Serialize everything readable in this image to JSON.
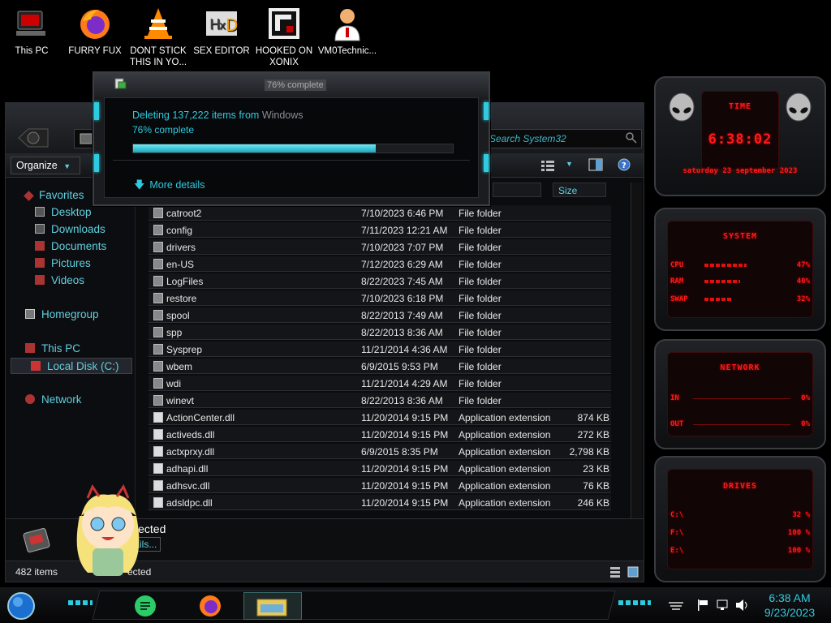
{
  "desktop": {
    "icons": [
      {
        "label": "This PC"
      },
      {
        "label": "FURRY FUX"
      },
      {
        "label": "DONT STICK THIS IN YO..."
      },
      {
        "label": "SEX EDITOR"
      },
      {
        "label": "HOOKED ON XONIX"
      },
      {
        "label": "VM0Technic..."
      }
    ]
  },
  "dialog": {
    "title": "76% complete",
    "heading_prefix": "Deleting 137,222 items from ",
    "heading_location": "Windows",
    "percent_text": "76% complete",
    "progress_value": 0.76,
    "more_details": "More details"
  },
  "explorer": {
    "search_placeholder": "Search System32",
    "organize": "Organize",
    "nav": {
      "favorites": "Favorites",
      "desktop": "Desktop",
      "downloads": "Downloads",
      "documents": "Documents",
      "pictures": "Pictures",
      "videos": "Videos",
      "homegroup": "Homegroup",
      "this_pc": "This PC",
      "local_disk": "Local Disk (C:)",
      "network": "Network"
    },
    "columns": {
      "size": "Size"
    },
    "rows": [
      {
        "name": "catroot2",
        "date": "7/10/2023 6:46 PM",
        "type": "File folder",
        "size": ""
      },
      {
        "name": "config",
        "date": "7/11/2023 12:21 AM",
        "type": "File folder",
        "size": ""
      },
      {
        "name": "drivers",
        "date": "7/10/2023 7:07 PM",
        "type": "File folder",
        "size": ""
      },
      {
        "name": "en-US",
        "date": "7/12/2023 6:29 AM",
        "type": "File folder",
        "size": ""
      },
      {
        "name": "LogFiles",
        "date": "8/22/2023 7:45 AM",
        "type": "File folder",
        "size": ""
      },
      {
        "name": "restore",
        "date": "7/10/2023 6:18 PM",
        "type": "File folder",
        "size": ""
      },
      {
        "name": "spool",
        "date": "8/22/2013 7:49 AM",
        "type": "File folder",
        "size": ""
      },
      {
        "name": "spp",
        "date": "8/22/2013 8:36 AM",
        "type": "File folder",
        "size": ""
      },
      {
        "name": "Sysprep",
        "date": "11/21/2014 4:36 AM",
        "type": "File folder",
        "size": ""
      },
      {
        "name": "wbem",
        "date": "6/9/2015 9:53 PM",
        "type": "File folder",
        "size": ""
      },
      {
        "name": "wdi",
        "date": "11/21/2014 4:29 AM",
        "type": "File folder",
        "size": ""
      },
      {
        "name": "winevt",
        "date": "8/22/2013 8:36 AM",
        "type": "File folder",
        "size": ""
      },
      {
        "name": "ActionCenter.dll",
        "date": "11/20/2014 9:15 PM",
        "type": "Application extension",
        "size": "874 KB"
      },
      {
        "name": "activeds.dll",
        "date": "11/20/2014 9:15 PM",
        "type": "Application extension",
        "size": "272 KB"
      },
      {
        "name": "actxprxy.dll",
        "date": "6/9/2015 8:35 PM",
        "type": "Application extension",
        "size": "2,798 KB"
      },
      {
        "name": "adhapi.dll",
        "date": "11/20/2014 9:15 PM",
        "type": "Application extension",
        "size": "23 KB"
      },
      {
        "name": "adhsvc.dll",
        "date": "11/20/2014 9:15 PM",
        "type": "Application extension",
        "size": "76 KB"
      },
      {
        "name": "adsldpc.dll",
        "date": "11/20/2014 9:15 PM",
        "type": "Application extension",
        "size": "246 KB"
      }
    ],
    "details_text": "lected",
    "details_link": "tails...",
    "status_count": "482 items",
    "status_selected": "ected"
  },
  "gadgets": {
    "time": {
      "title": "TIME",
      "clock": "6:38:02",
      "date": "saturday 23 september 2023"
    },
    "system": {
      "title": "SYSTEM",
      "rows": [
        {
          "label": "CPU",
          "value": "47%",
          "level": 0.47
        },
        {
          "label": "RAM",
          "value": "40%",
          "level": 0.4
        },
        {
          "label": "SWAP",
          "value": "32%",
          "level": 0.32
        }
      ]
    },
    "network": {
      "title": "NETWORK",
      "in_label": "IN",
      "in_value": "0%",
      "out_label": "OUT",
      "out_value": "0%"
    },
    "drives": {
      "title": "DRIVES",
      "rows": [
        {
          "label": "C:\\",
          "value": "32 %"
        },
        {
          "label": "F:\\",
          "value": "100 %"
        },
        {
          "label": "E:\\",
          "value": "100 %"
        }
      ]
    }
  },
  "taskbar": {
    "time": "6:38 AM",
    "date": "9/23/2023"
  },
  "colors": {
    "accent": "#2ecbe0",
    "alien_red": "#ff1a1a",
    "link": "#5fd0e0"
  }
}
